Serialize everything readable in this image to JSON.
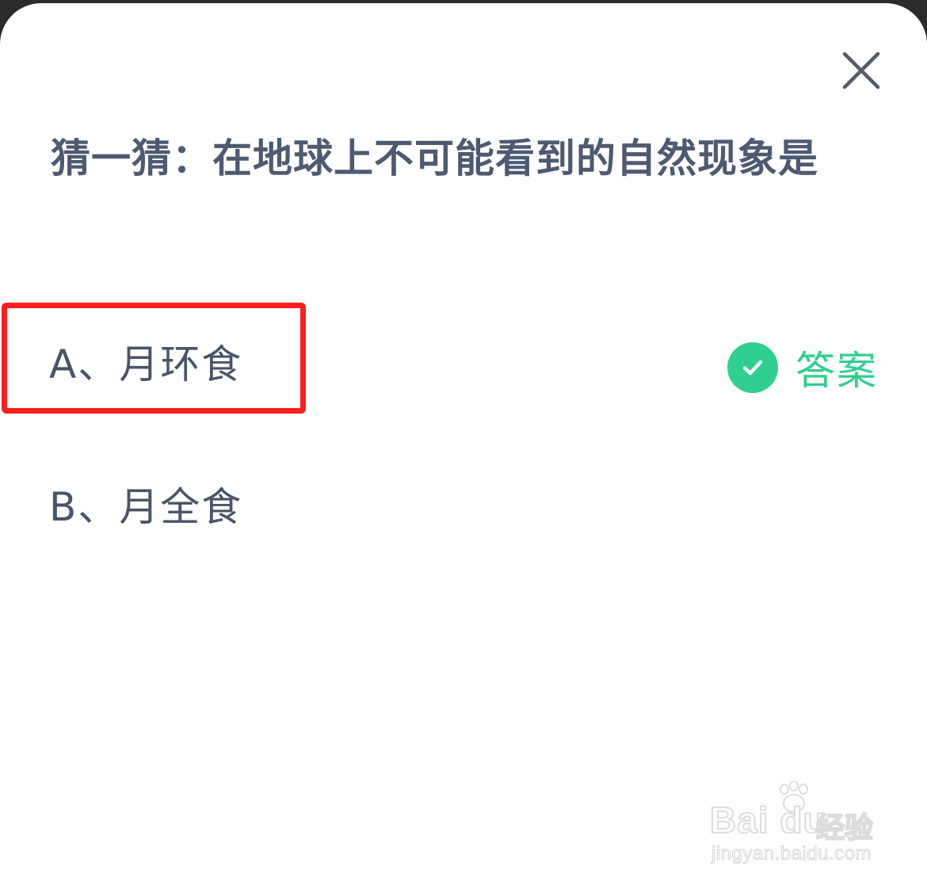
{
  "dialog": {
    "question": "猜一猜：在地球上不可能看到的自然现象是",
    "close_icon": "close-icon"
  },
  "options": [
    {
      "label": "A、月环食",
      "is_answer": true
    },
    {
      "label": "B、月全食",
      "is_answer": false
    }
  ],
  "answer_tag": {
    "label": "答案",
    "icon": "check-circle-icon",
    "color": "#2fcf8f"
  },
  "highlight": {
    "color": "#ff1e1e"
  },
  "watermark": {
    "brand": "Bai du",
    "product": "经验",
    "url": "jingyan.baidu.com"
  },
  "colors": {
    "question_text": "#4d5a72",
    "option_text": "#4a5468",
    "background": "#ffffff"
  }
}
